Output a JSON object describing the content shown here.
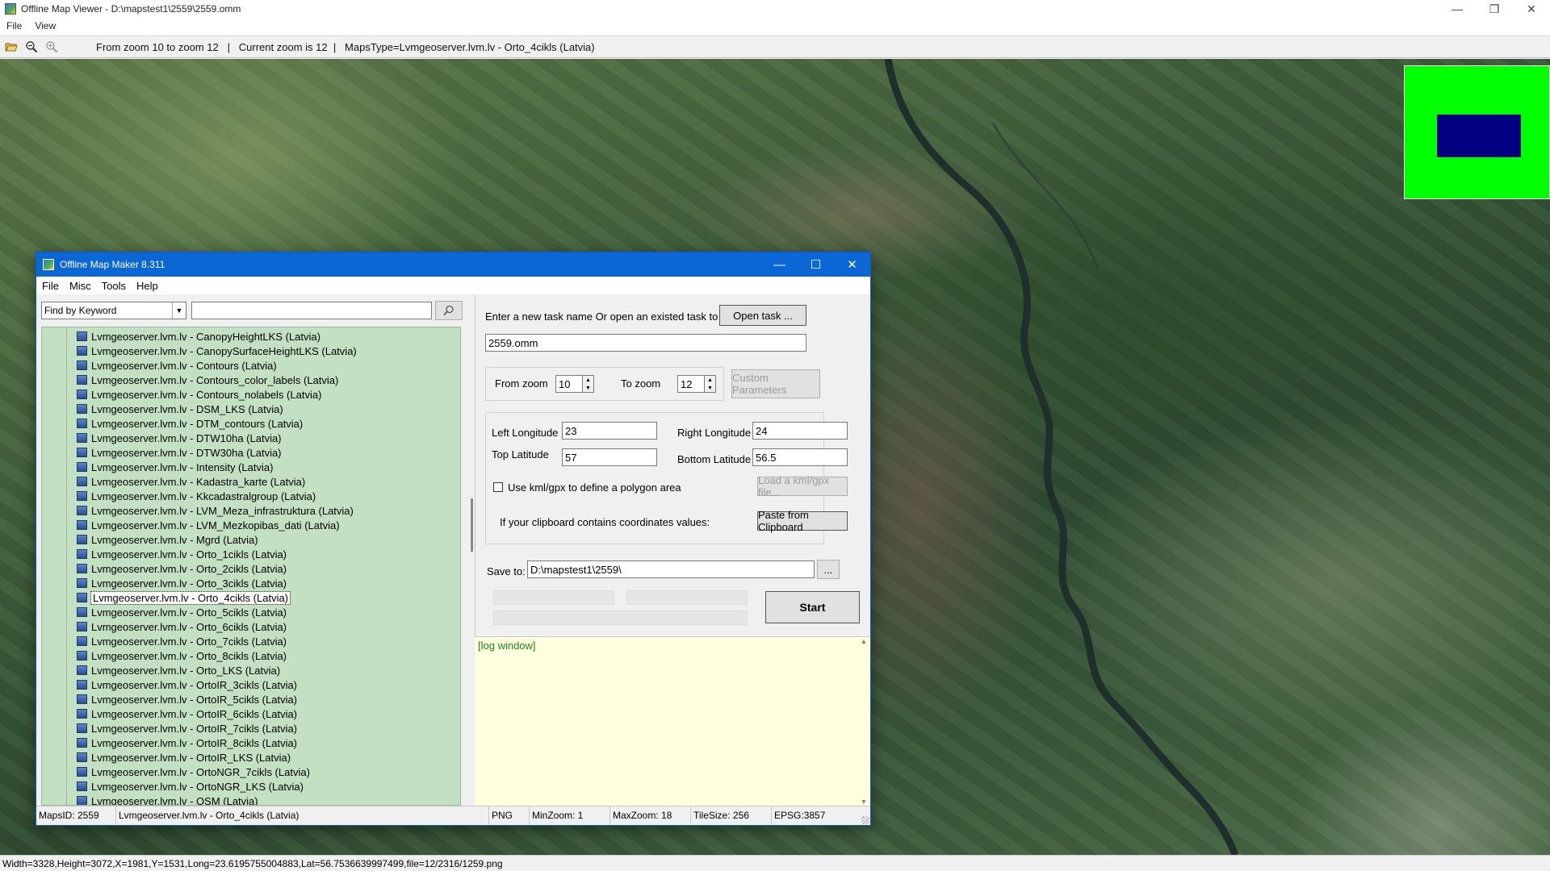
{
  "window": {
    "title": "Offline Map Viewer - D:\\mapstest1\\2559\\2559.omm",
    "controls": {
      "minimize": "—",
      "restore": "❐",
      "close": "✕"
    }
  },
  "menubar": {
    "items": [
      "File",
      "View"
    ]
  },
  "toolbar": {
    "info": "From zoom 10 to zoom 12   |   Current zoom is 12  |   MapsType=Lvmgeoserver.lvm.lv - Orto_4cikls (Latvia)"
  },
  "status": "Width=3328,Height=3072,X=1981,Y=1531,Long=23.6195755004883,Lat=56.7536639997499,file=12/2316/1259.png",
  "colors": {
    "minimap_bg": "#00ff00",
    "minimap_view": "#000080",
    "dialog_title": "#0b66d6",
    "tree_bg": "#c3e0c3",
    "log_bg": "#ffffe0"
  },
  "dialog": {
    "title": "Offline Map Maker 8.311",
    "controls": {
      "minimize": "—",
      "maximize": "☐",
      "close": "✕"
    },
    "menu": [
      "File",
      "Misc",
      "Tools",
      "Help"
    ],
    "search": {
      "mode": "Find by Keyword",
      "value": ""
    },
    "tree_items": [
      "Lvmgeoserver.lvm.lv - CanopyHeightLKS (Latvia)",
      "Lvmgeoserver.lvm.lv - CanopySurfaceHeightLKS (Latvia)",
      "Lvmgeoserver.lvm.lv - Contours (Latvia)",
      "Lvmgeoserver.lvm.lv - Contours_color_labels (Latvia)",
      "Lvmgeoserver.lvm.lv - Contours_nolabels (Latvia)",
      "Lvmgeoserver.lvm.lv - DSM_LKS (Latvia)",
      "Lvmgeoserver.lvm.lv - DTM_contours (Latvia)",
      "Lvmgeoserver.lvm.lv - DTW10ha (Latvia)",
      "Lvmgeoserver.lvm.lv - DTW30ha (Latvia)",
      "Lvmgeoserver.lvm.lv - Intensity (Latvia)",
      "Lvmgeoserver.lvm.lv - Kadastra_karte (Latvia)",
      "Lvmgeoserver.lvm.lv - Kkcadastralgroup (Latvia)",
      "Lvmgeoserver.lvm.lv - LVM_Meza_infrastruktura (Latvia)",
      "Lvmgeoserver.lvm.lv - LVM_Mezkopibas_dati (Latvia)",
      "Lvmgeoserver.lvm.lv - Mgrd (Latvia)",
      "Lvmgeoserver.lvm.lv - Orto_1cikls (Latvia)",
      "Lvmgeoserver.lvm.lv - Orto_2cikls (Latvia)",
      "Lvmgeoserver.lvm.lv - Orto_3cikls (Latvia)",
      "Lvmgeoserver.lvm.lv - Orto_4cikls (Latvia)",
      "Lvmgeoserver.lvm.lv - Orto_5cikls (Latvia)",
      "Lvmgeoserver.lvm.lv - Orto_6cikls (Latvia)",
      "Lvmgeoserver.lvm.lv - Orto_7cikls (Latvia)",
      "Lvmgeoserver.lvm.lv - Orto_8cikls (Latvia)",
      "Lvmgeoserver.lvm.lv - Orto_LKS (Latvia)",
      "Lvmgeoserver.lvm.lv - OrtoIR_3cikls (Latvia)",
      "Lvmgeoserver.lvm.lv - OrtoIR_5cikls (Latvia)",
      "Lvmgeoserver.lvm.lv - OrtoIR_6cikls (Latvia)",
      "Lvmgeoserver.lvm.lv - OrtoIR_7cikls (Latvia)",
      "Lvmgeoserver.lvm.lv - OrtoIR_8cikls (Latvia)",
      "Lvmgeoserver.lvm.lv - OrtoIR_LKS (Latvia)",
      "Lvmgeoserver.lvm.lv - OrtoNGR_7cikls (Latvia)",
      "Lvmgeoserver.lvm.lv - OrtoNGR_LKS (Latvia)",
      "Lvmgeoserver.lvm.lv - OSM (Latvia)"
    ],
    "selected_item": "Lvmgeoserver.lvm.lv - Orto_4cikls (Latvia)",
    "task": {
      "prompt": "Enter a new task name Or open an existed task to continue:",
      "open_button": "Open task ...",
      "name": "2559.omm"
    },
    "zoom": {
      "from_label": "From zoom",
      "from_value": "10",
      "to_label": "To zoom",
      "to_value": "12",
      "custom_button": "Custom Parameters"
    },
    "coords": {
      "left_label": "Left Longitude",
      "left_value": "23",
      "right_label": "Right Longitude",
      "right_value": "24",
      "top_label": "Top Latitude",
      "top_value": "57",
      "bottom_label": "Bottom Latitude",
      "bottom_value": "56.5",
      "kml_label": "Use kml/gpx to define a polygon area",
      "kml_checked": false,
      "kml_button": "Load a kml/gpx file...",
      "clipboard_label": "If your clipboard contains coordinates values:",
      "clipboard_button": "Paste from Clipboard"
    },
    "save": {
      "label": "Save to:",
      "path": "D:\\mapstest1\\2559\\",
      "browse": "..."
    },
    "start_button": "Start",
    "log": "[log window]",
    "status": {
      "maps_id": "MapsID: 2559",
      "map_name": "Lvmgeoserver.lvm.lv - Orto_4cikls (Latvia)",
      "format": "PNG",
      "min_zoom": "MinZoom: 1",
      "max_zoom": "MaxZoom: 18",
      "tile_size": "TileSize: 256",
      "epsg": "EPSG:3857"
    }
  }
}
